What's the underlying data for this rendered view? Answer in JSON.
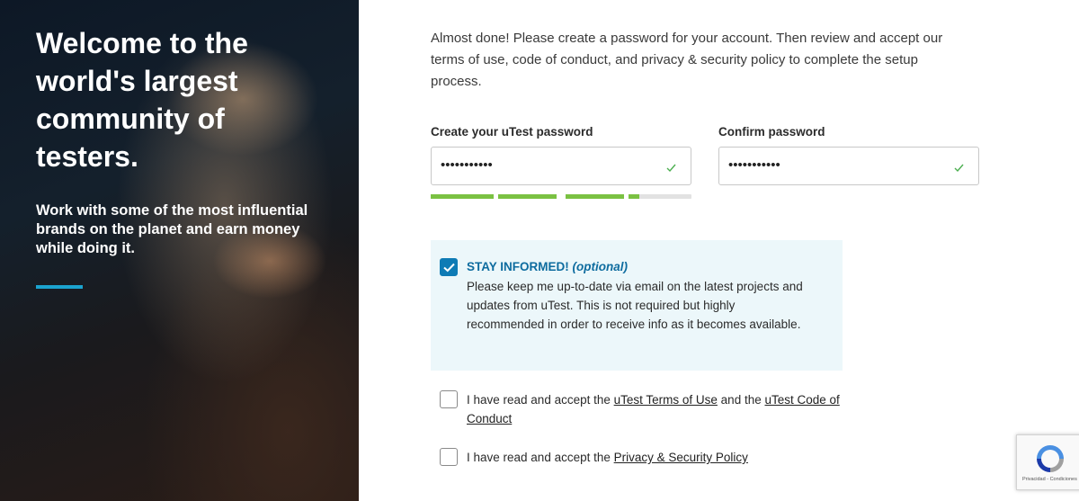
{
  "hero": {
    "title": "Welcome to the world's largest community of testers.",
    "subtitle": "Work with some of the most influential brands on the planet and earn money while doing it."
  },
  "intro_text": "Almost done! Please create a password for your account. Then review and accept our terms of use, code of conduct, and privacy & security policy to complete the setup process.",
  "password": {
    "label": "Create your uTest password",
    "value": "•••••••••••",
    "valid_icon": "check-icon"
  },
  "confirm": {
    "label": "Confirm password",
    "value": "•••••••••••",
    "valid_icon": "check-icon"
  },
  "strength_meter": {
    "segments_filled": [
      1,
      1,
      1,
      0.17
    ]
  },
  "stay_informed": {
    "checked": true,
    "title": "STAY INFORMED!",
    "optional": "(optional)",
    "body": "Please keep me up-to-date via email on the latest projects and updates from uTest. This is not required but highly recommended in order to receive info as it becomes available."
  },
  "terms": {
    "checked": false,
    "prefix": "I have read and accept the ",
    "link1": "uTest Terms of Use",
    "middle": " and the ",
    "link2": "uTest Code of Conduct"
  },
  "privacy": {
    "checked": false,
    "prefix": "I have read and accept the ",
    "link": "Privacy & Security Policy"
  },
  "recaptcha": {
    "links": "Privacidad - Condiciones"
  },
  "colors": {
    "accent": "#1ba3cf",
    "checkbox_blue": "#0e7bb5",
    "strength_green": "#7ac142",
    "informed_bg": "#ecf7fa"
  }
}
